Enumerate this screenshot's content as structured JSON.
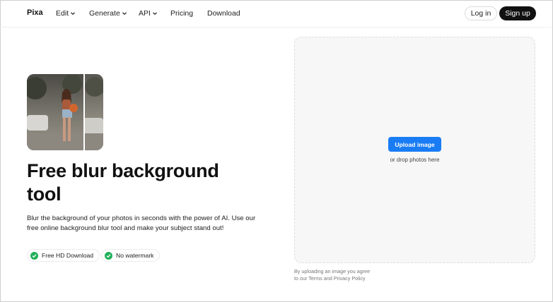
{
  "header": {
    "logo": "Pixa",
    "nav": [
      {
        "label": "Edit",
        "has_dropdown": true
      },
      {
        "label": "Generate",
        "has_dropdown": true
      },
      {
        "label": "API",
        "has_dropdown": true
      },
      {
        "label": "Pricing",
        "has_dropdown": false
      },
      {
        "label": "Download",
        "has_dropdown": false
      }
    ],
    "login_label": "Log in",
    "signup_label": "Sign up"
  },
  "hero": {
    "image_icon": "before-after-photo",
    "title": "Free blur background tool",
    "description": "Blur the background of your photos in seconds with the power of AI. Use our free online background blur tool and make your subject stand out!",
    "badges": [
      {
        "label": "Free HD Download",
        "icon": "check-icon"
      },
      {
        "label": "No watermark",
        "icon": "check-icon"
      }
    ]
  },
  "upload": {
    "button_label": "Upload image",
    "drop_text": "or drop photos here",
    "terms_line1": "By uploading an image you agree",
    "terms_line2": "to our Terms and Privacy Policy"
  },
  "colors": {
    "accent": "#1a7cf4",
    "signup_bg": "#111111",
    "check_green": "#22b05a",
    "dropzone_bg": "#f7f7f7"
  }
}
